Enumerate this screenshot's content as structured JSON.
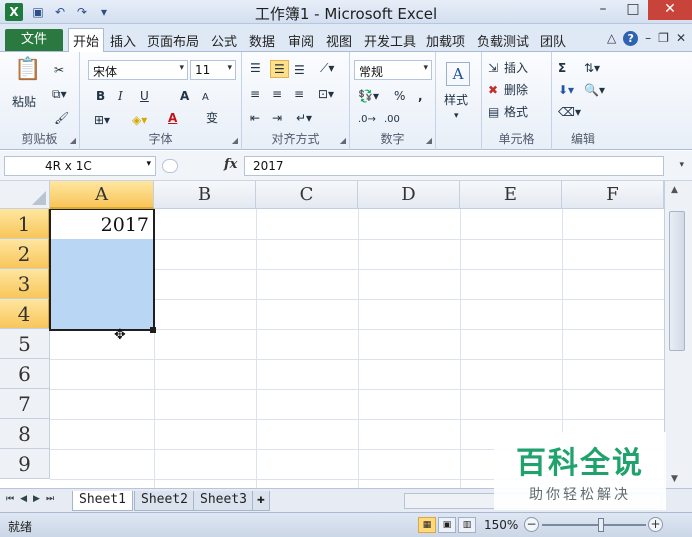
{
  "window": {
    "title": "工作簿1 - Microsoft Excel",
    "logo": "X",
    "qat": {
      "save": "save-icon",
      "undo": "undo-icon",
      "redo": "redo-icon"
    }
  },
  "tabs": {
    "file": "文件",
    "items": [
      "开始",
      "插入",
      "页面布局",
      "公式",
      "数据",
      "审阅",
      "视图",
      "开发工具",
      "加载项",
      "负载测试",
      "团队"
    ],
    "help": "?"
  },
  "ribbon": {
    "clipboard": {
      "paste": "粘贴",
      "label": "剪贴板"
    },
    "font": {
      "name": "宋体",
      "size": "11",
      "bold": "B",
      "italic": "I",
      "underline": "U",
      "grow": "A",
      "shrink": "A",
      "fontcolor": "A",
      "phonetic": "变",
      "label": "字体"
    },
    "alignment": {
      "label": "对齐方式"
    },
    "number": {
      "format": "常规",
      "percent": "%",
      "comma": ",",
      "label": "数字"
    },
    "styles": {
      "label": "样式"
    },
    "cells": {
      "insert": "插入",
      "delete": "删除",
      "format": "格式",
      "label": "单元格"
    },
    "editing": {
      "sum": "Σ",
      "label": "编辑"
    }
  },
  "formula_bar": {
    "name_box": "4R x 1C",
    "fx": "fx",
    "value": "2017"
  },
  "grid": {
    "columns": [
      "A",
      "B",
      "C",
      "D",
      "E",
      "F"
    ],
    "rows": [
      "1",
      "2",
      "3",
      "4",
      "5",
      "6",
      "7",
      "8",
      "9"
    ],
    "cells": {
      "A1": "2017"
    }
  },
  "sheets": [
    "Sheet1",
    "Sheet2",
    "Sheet3"
  ],
  "status": {
    "ready": "就绪",
    "zoom": "150%"
  },
  "watermark": {
    "main": "百科全说",
    "sub": "助你轻松解决"
  }
}
